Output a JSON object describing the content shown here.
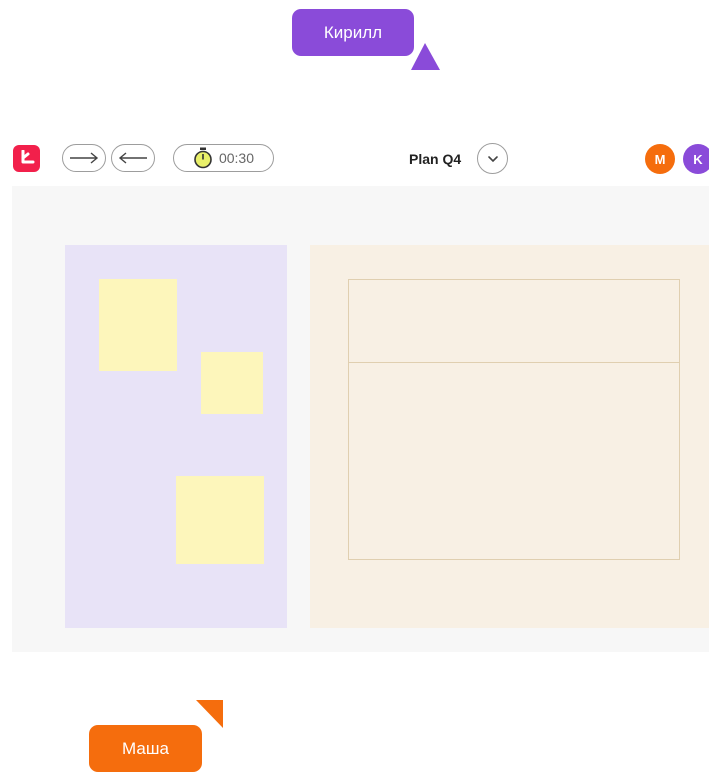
{
  "cursors": [
    {
      "name": "Кирилл",
      "color": "#8a4bd9"
    },
    {
      "name": "Маша",
      "color": "#f56d0d"
    }
  ],
  "toolbar": {
    "logo_icon": "app-logo-icon",
    "redo_icon": "arrow-right-icon",
    "undo_icon": "arrow-left-icon",
    "timer_icon": "stopwatch-icon",
    "timer_value": "00:30",
    "board_title": "Plan Q4",
    "board_menu_icon": "chevron-down-icon"
  },
  "participants": [
    {
      "initial": "M",
      "color": "#f56d0d"
    },
    {
      "initial": "K",
      "color": "#8a4bd9"
    }
  ],
  "colors": {
    "brand": "#f2204b",
    "canvas_background": "#f7f7f7",
    "frame_left": "#e8e3f7",
    "frame_right": "#f8f0e4",
    "sticky_note": "#fdf6bb"
  }
}
